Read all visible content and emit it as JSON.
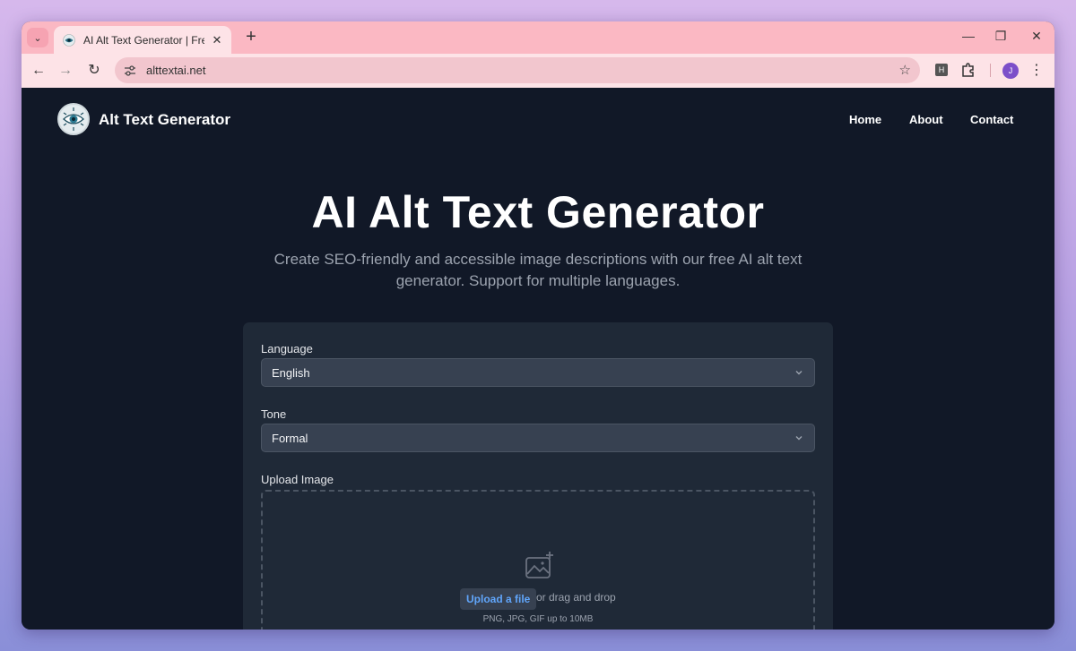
{
  "browser": {
    "tab_title": "AI Alt Text Generator | Free Tool",
    "url": "alttextai.net",
    "avatar_letter": "J",
    "extension_letter": "H"
  },
  "site": {
    "brand": "Alt Text Generator",
    "nav": [
      "Home",
      "About",
      "Contact"
    ]
  },
  "hero": {
    "title": "AI Alt Text Generator",
    "subtitle": "Create SEO-friendly and accessible image descriptions with our free AI alt text generator. Support for multiple languages."
  },
  "form": {
    "language_label": "Language",
    "language_value": "English",
    "tone_label": "Tone",
    "tone_value": "Formal",
    "upload_label": "Upload Image",
    "upload_button": "Upload a file",
    "drag_text": "or drag and drop",
    "hint": "PNG, JPG, GIF up to 10MB"
  },
  "colors": {
    "page_bg": "#111827",
    "card_bg": "#1f2937",
    "accent_link": "#60a5fa",
    "tab_strip": "#fbb8c3"
  }
}
